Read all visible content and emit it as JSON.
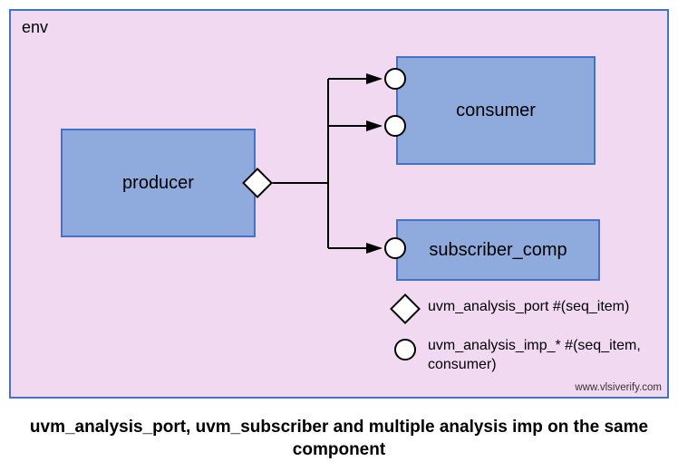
{
  "env_label": "env",
  "producer_label": "producer",
  "consumer_label": "consumer",
  "subscriber_label": "subscriber_comp",
  "legend": {
    "port_text": "uvm_analysis_port #(seq_item)",
    "imp_text": "uvm_analysis_imp_* #(seq_item, consumer)"
  },
  "caption": "uvm_analysis_port, uvm_subscriber and multiple analysis imp on the same component",
  "watermark": "www.vlsiverify.com",
  "diagram": {
    "components": [
      "producer",
      "consumer",
      "subscriber_comp"
    ],
    "connections": [
      {
        "from": "producer.analysis_port",
        "to": "consumer.analysis_imp_1"
      },
      {
        "from": "producer.analysis_port",
        "to": "consumer.analysis_imp_2"
      },
      {
        "from": "producer.analysis_port",
        "to": "subscriber_comp.analysis_export"
      }
    ],
    "port_symbols": {
      "diamond": "uvm_analysis_port",
      "circle": "uvm_analysis_imp"
    }
  }
}
